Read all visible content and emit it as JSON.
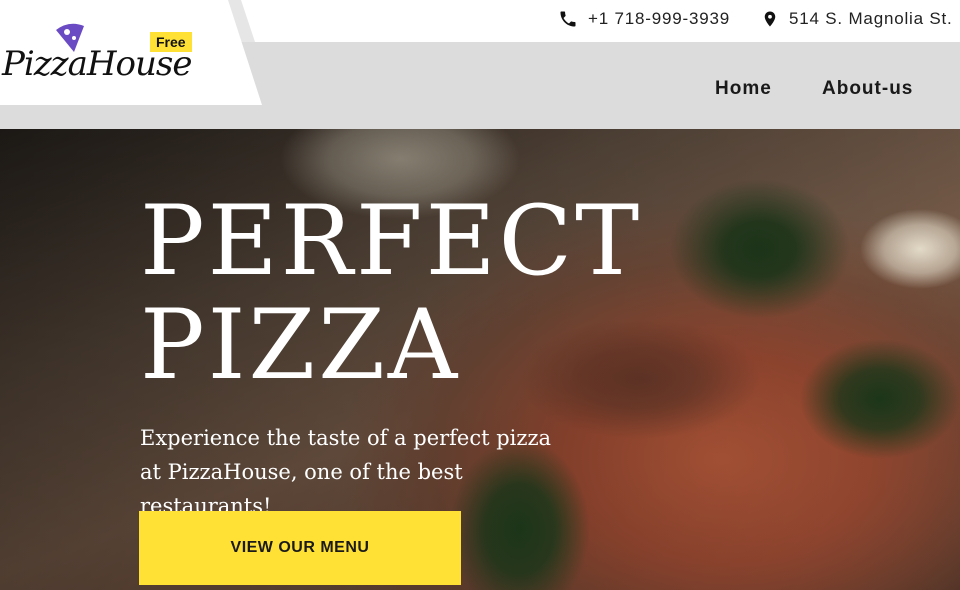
{
  "logo": {
    "text": "PizzaHouse",
    "badge": "Free",
    "icon": "pizza-slice-icon"
  },
  "contact": {
    "phone": "+1 718-999-3939",
    "phone_icon": "phone-icon",
    "address": "514 S. Magnolia St.",
    "address_icon": "map-pin-icon"
  },
  "nav": {
    "items": [
      {
        "label": "Home"
      },
      {
        "label": "About-us"
      }
    ]
  },
  "hero": {
    "title_line1": "PERFECT",
    "title_line2": "PIZZA",
    "description": "Experience the taste of a perfect pizza at PizzaHouse, one of the best restaurants!",
    "cta_label": "VIEW OUR MENU"
  },
  "colors": {
    "accent": "#ffe135",
    "header_bg": "#dcdcdc",
    "topbar_bg": "#ffffff",
    "text_dark": "#1a1a1a",
    "logo_purple": "#6a4bc4"
  }
}
